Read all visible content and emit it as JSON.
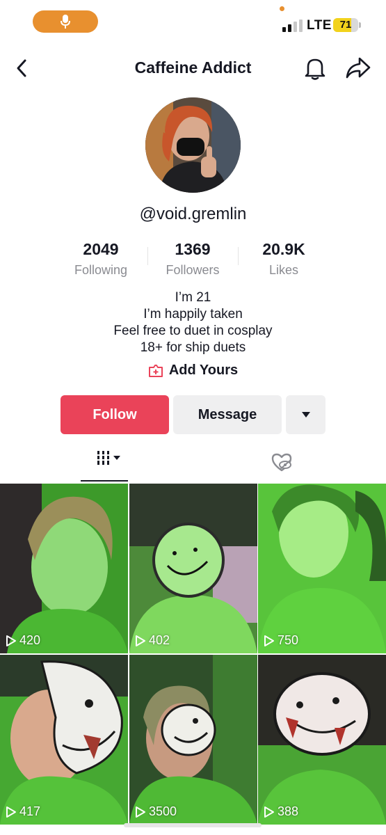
{
  "status_bar": {
    "network": "LTE",
    "battery_level": "71",
    "battery_fraction": 0.71
  },
  "header": {
    "title": "Caffeine Addict"
  },
  "profile": {
    "username": "@void.gremlin",
    "stats": [
      {
        "number": "2049",
        "label": "Following"
      },
      {
        "number": "1369",
        "label": "Followers"
      },
      {
        "number": "20.9K",
        "label": "Likes"
      }
    ],
    "bio_lines": [
      "I’m 21",
      "I’m happily taken",
      "Feel free to duet in cosplay",
      "18+ for ship duets"
    ],
    "add_yours": "Add Yours"
  },
  "actions": {
    "follow": "Follow",
    "message": "Message"
  },
  "videos": [
    {
      "views": "420"
    },
    {
      "views": "402"
    },
    {
      "views": "750"
    },
    {
      "views": "417"
    },
    {
      "views": "3500"
    },
    {
      "views": "388"
    }
  ],
  "colors": {
    "follow_button": "#ea4359",
    "mic_pill": "#e8902f",
    "battery": "#f2d21b",
    "video_tint": "#5ccf3a"
  }
}
